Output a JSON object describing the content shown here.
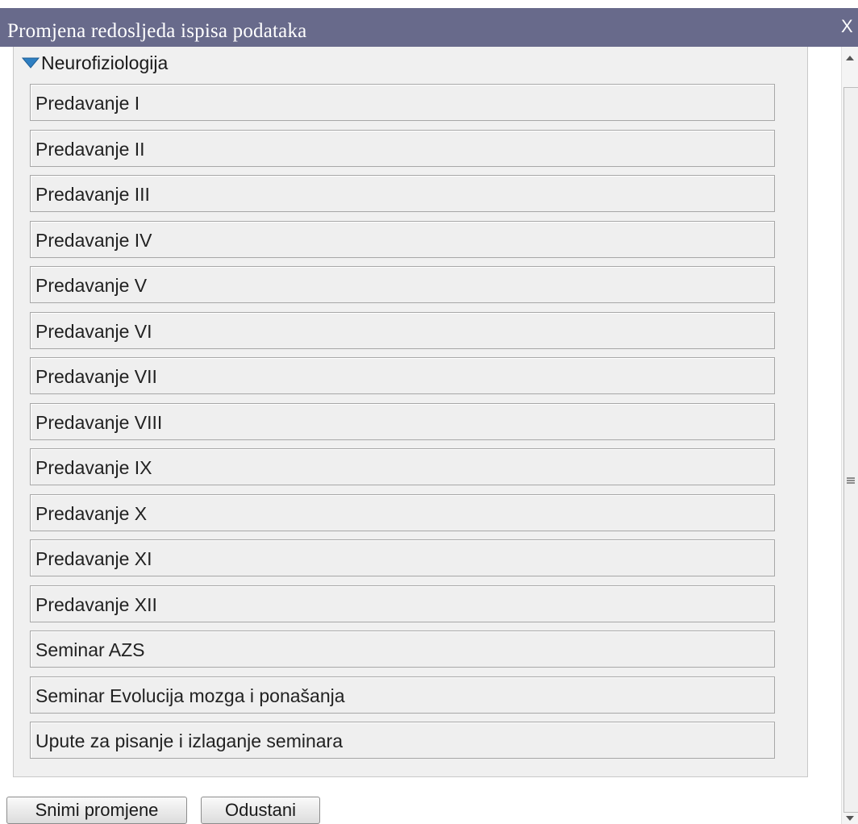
{
  "dialog": {
    "title": "Promjena redosljeda ispisa podataka",
    "close_label": "X"
  },
  "group": {
    "label": "Neurofiziologija",
    "items": [
      "Predavanje I",
      "Predavanje II",
      "Predavanje III",
      "Predavanje IV",
      "Predavanje V",
      "Predavanje VI",
      "Predavanje VII",
      "Predavanje VIII",
      "Predavanje IX",
      "Predavanje X",
      "Predavanje XI",
      "Predavanje XII",
      "Seminar AZS",
      "Seminar Evolucija mozga i ponašanja",
      "Upute za pisanje i izlaganje seminara"
    ]
  },
  "buttons": {
    "save_label": "Snimi promjene",
    "cancel_label": "Odustani"
  },
  "colors": {
    "titlebar": "#686a8b",
    "expand_triangle": "#2e7fc2"
  },
  "icons": {
    "expand": "triangle-down-icon",
    "close": "close-icon",
    "scroll_up": "scroll-up-arrow-icon",
    "scroll_down": "scroll-down-arrow-icon"
  }
}
